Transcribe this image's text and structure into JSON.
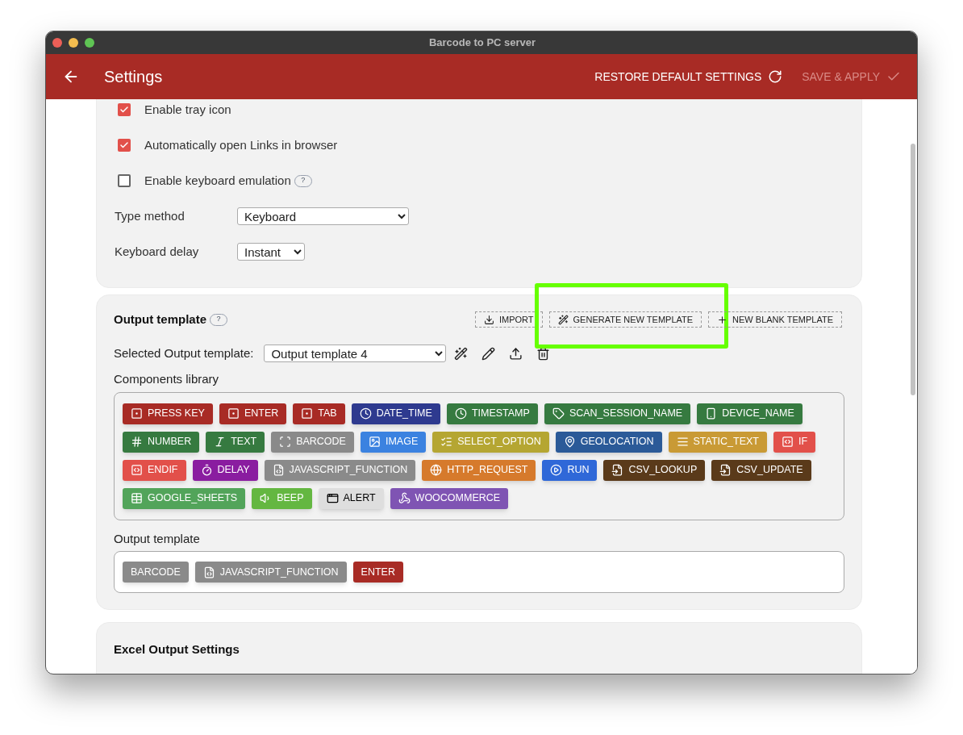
{
  "window": {
    "title": "Barcode to PC server"
  },
  "app_bar": {
    "title": "Settings",
    "actions": [
      {
        "label": "RESTORE DEFAULT SETTINGS",
        "kind": "refresh",
        "disabled": false
      },
      {
        "label": "SAVE & APPLY",
        "kind": "check",
        "disabled": true
      }
    ]
  },
  "general": {
    "checkboxes": [
      {
        "label": "Enable tray icon",
        "checked": true
      },
      {
        "label": "Automatically open Links in browser",
        "checked": true
      },
      {
        "label": "Enable keyboard emulation",
        "checked": false,
        "help": "?"
      }
    ],
    "selects": [
      {
        "label": "Type method",
        "value": "Keyboard"
      },
      {
        "label": "Keyboard delay",
        "value": "Instant"
      }
    ]
  },
  "output_template": {
    "title": "Output template",
    "help": "?",
    "buttons": [
      {
        "label": "IMPORT",
        "kind": "import",
        "highlighted": false
      },
      {
        "label": "GENERATE NEW TEMPLATE",
        "kind": "generate",
        "highlighted": true
      },
      {
        "label": "NEW BLANK TEMPLATE",
        "kind": "plus",
        "highlighted": false
      }
    ],
    "selected_label": "Selected Output template:",
    "selected_value": "Output template 4",
    "tools": [
      {
        "kind": "generate"
      },
      {
        "kind": "edit"
      },
      {
        "kind": "export"
      },
      {
        "kind": "delete"
      }
    ],
    "library_title": "Components library",
    "library": [
      {
        "label": "PRESS KEY",
        "kind": "key",
        "color": "#a82b25"
      },
      {
        "label": "ENTER",
        "kind": "key",
        "color": "#a82b25"
      },
      {
        "label": "TAB",
        "kind": "key",
        "color": "#a82b25"
      },
      {
        "label": "DATE_TIME",
        "kind": "clock",
        "color": "#2e3a8f"
      },
      {
        "label": "TIMESTAMP",
        "kind": "clock",
        "color": "#367a40"
      },
      {
        "label": "SCAN_SESSION_NAME",
        "kind": "tag",
        "color": "#367a40"
      },
      {
        "label": "DEVICE_NAME",
        "kind": "phone",
        "color": "#367a40"
      },
      {
        "label": "NUMBER",
        "kind": "number",
        "color": "#367a40"
      },
      {
        "label": "TEXT",
        "kind": "text",
        "color": "#367a40"
      },
      {
        "label": "BARCODE",
        "kind": "scan",
        "color": "#8a8a8a"
      },
      {
        "label": "IMAGE",
        "kind": "image",
        "color": "#3b82e0"
      },
      {
        "label": "SELECT_OPTION",
        "kind": "list",
        "color": "#b5a632"
      },
      {
        "label": "GEOLOCATION",
        "kind": "pin",
        "color": "#2b5a98"
      },
      {
        "label": "STATIC_TEXT",
        "kind": "lines",
        "color": "#c99a35"
      },
      {
        "label": "IF",
        "kind": "code",
        "color": "#e2504a"
      },
      {
        "label": "ENDIF",
        "kind": "code",
        "color": "#e2504a"
      },
      {
        "label": "DELAY",
        "kind": "timer",
        "color": "#8a1da0"
      },
      {
        "label": "JAVASCRIPT_FUNCTION",
        "kind": "file-code",
        "color": "#8a8a8a"
      },
      {
        "label": "HTTP_REQUEST",
        "kind": "globe",
        "color": "#d67a2c"
      },
      {
        "label": "RUN",
        "kind": "play",
        "color": "#2f68d8"
      },
      {
        "label": "CSV_LOOKUP",
        "kind": "file-in",
        "color": "#5a3a1a"
      },
      {
        "label": "CSV_UPDATE",
        "kind": "file-in",
        "color": "#5a3a1a"
      },
      {
        "label": "GOOGLE_SHEETS",
        "kind": "table",
        "color": "#52a45a"
      },
      {
        "label": "BEEP",
        "kind": "speaker",
        "color": "#64b741"
      },
      {
        "label": "ALERT",
        "kind": "window",
        "color": "#dedede"
      },
      {
        "label": "WOOCOMMERCE",
        "kind": "webhook",
        "color": "#7f54b3"
      }
    ],
    "template_title": "Output template",
    "template": [
      {
        "label": "BARCODE",
        "kind": "plain",
        "color": "#8a8a8a"
      },
      {
        "label": "JAVASCRIPT_FUNCTION",
        "kind": "file-code",
        "color": "#8a8a8a"
      },
      {
        "label": "ENTER",
        "kind": "plain",
        "color": "#a82b25"
      }
    ]
  },
  "excel": {
    "title": "Excel Output Settings"
  }
}
